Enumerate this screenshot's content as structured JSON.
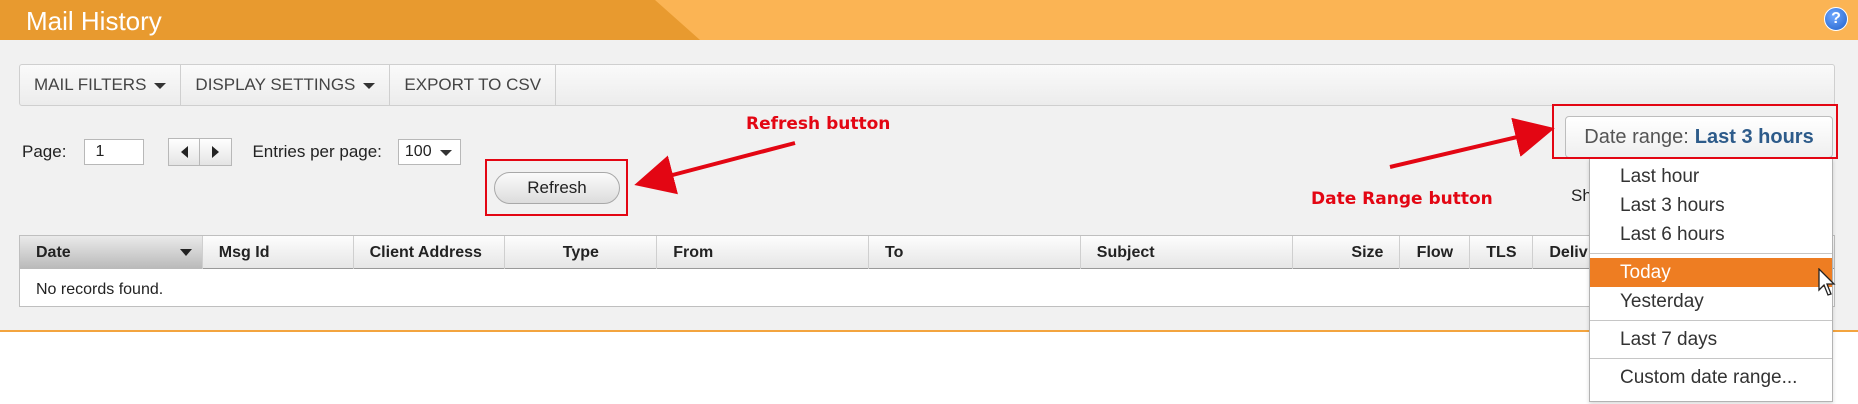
{
  "header": {
    "title": "Mail History",
    "help_glyph": "?"
  },
  "toolbar": {
    "mail_filters": "MAIL FILTERS",
    "display_settings": "DISPLAY SETTINGS",
    "export_csv": "EXPORT TO CSV"
  },
  "pager": {
    "page_label": "Page:",
    "page_value": "1",
    "entries_label": "Entries per page:",
    "entries_value": "100",
    "refresh_label": "Refresh"
  },
  "date_range": {
    "label": "Date range:",
    "value": "Last 3 hours",
    "options": [
      "Last hour",
      "Last 3 hours",
      "Last 6 hours",
      "Today",
      "Yesterday",
      "Last 7 days",
      "Custom date range..."
    ],
    "highlighted": "Today"
  },
  "show_label": "Sh",
  "grid": {
    "columns": [
      "Date",
      "Msg Id",
      "Client Address",
      "Type",
      "From",
      "To",
      "Subject",
      "Size",
      "Flow",
      "TLS",
      "Deliv"
    ],
    "empty_text": "No records found."
  },
  "annotations": {
    "refresh": "Refresh button",
    "date_range": "Date Range button"
  },
  "colors": {
    "header_orange": "#fbb454",
    "header_tab": "#e89a2f",
    "highlight": "#ee7d22",
    "annotation_red": "#e30613",
    "date_value_blue": "#2d5b8a"
  }
}
